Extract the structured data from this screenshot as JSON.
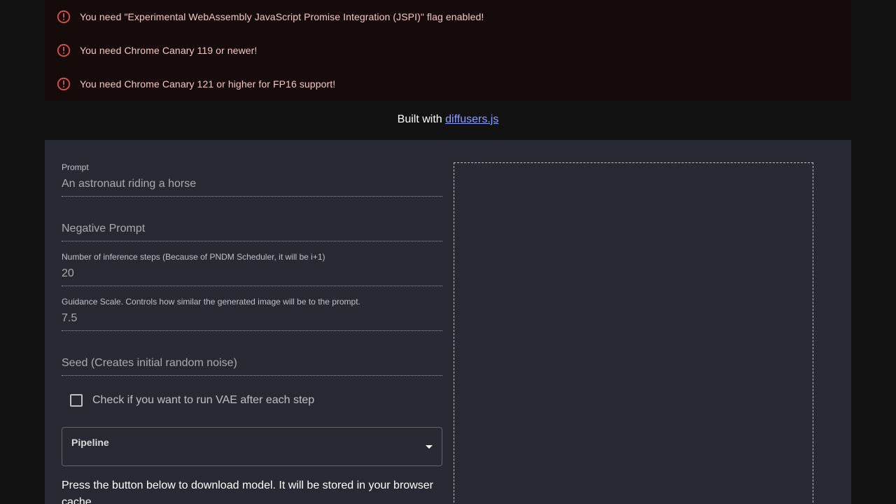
{
  "alerts": [
    {
      "icon": "error-icon",
      "text": "You need \"Experimental WebAssembly JavaScript Promise Integration (JSPI)\" flag enabled!"
    },
    {
      "icon": "error-icon",
      "text": "You need Chrome Canary 119 or newer!"
    },
    {
      "icon": "error-icon",
      "text": "You need Chrome Canary 121 or higher for FP16 support!"
    }
  ],
  "colors": {
    "alert_icon": "#e0504f",
    "link": "#8c9eff"
  },
  "footer": {
    "prefix": "Built with",
    "link_text": "diffusers.js"
  },
  "form": {
    "prompt": {
      "label": "Prompt",
      "value": "An astronaut riding a horse"
    },
    "negative_prompt": {
      "placeholder": "Negative Prompt"
    },
    "steps": {
      "label": "Number of inference steps (Because of PNDM Scheduler, it will be i+1)",
      "value": "20"
    },
    "guidance": {
      "label": "Guidance Scale. Controls how similar the generated image will be to the prompt.",
      "value": "7.5"
    },
    "seed": {
      "placeholder": "Seed (Creates initial random noise)"
    },
    "vae_checkbox": {
      "label": "Check if you want to run VAE after each step",
      "checked": false
    },
    "pipeline": {
      "label": "Pipeline"
    },
    "download_text": "Press the button below to download model. It will be stored in your browser cache."
  }
}
